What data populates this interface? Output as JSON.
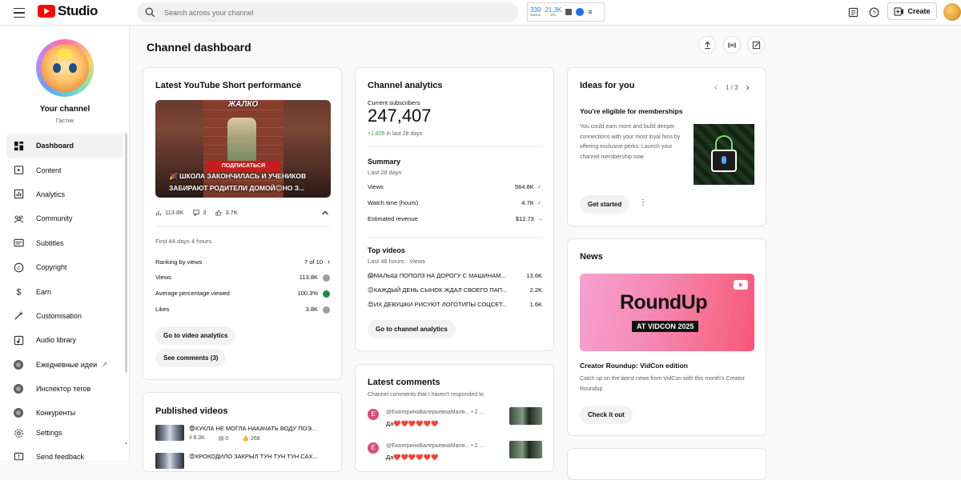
{
  "header": {
    "logo_text": "Studio",
    "search_placeholder": "Search across your channel",
    "ext": {
      "stat1_value": "339",
      "stat1_label": "60мин",
      "stat2_value": "21.3K",
      "stat2_label": "48ч"
    },
    "create_label": "Create"
  },
  "sidebar": {
    "channel_name": "Your channel",
    "channel_handle": "Гастик",
    "items": [
      {
        "label": "Dashboard",
        "icon": "dashboard-icon"
      },
      {
        "label": "Content",
        "icon": "content-icon"
      },
      {
        "label": "Analytics",
        "icon": "analytics-icon"
      },
      {
        "label": "Community",
        "icon": "community-icon"
      },
      {
        "label": "Subtitles",
        "icon": "subtitles-icon"
      },
      {
        "label": "Copyright",
        "icon": "copyright-icon"
      },
      {
        "label": "Earn",
        "icon": "dollar-icon"
      },
      {
        "label": "Customisation",
        "icon": "magic-wand-icon"
      },
      {
        "label": "Audio library",
        "icon": "audio-library-icon"
      },
      {
        "label": "Ежедневные идеи",
        "icon": "extension-icon"
      },
      {
        "label": "Инспектор тегов",
        "icon": "extension-icon"
      },
      {
        "label": "Конкуренты",
        "icon": "extension-icon"
      }
    ],
    "bottom": [
      {
        "label": "Settings",
        "icon": "gear-icon"
      },
      {
        "label": "Send feedback",
        "icon": "feedback-icon"
      }
    ]
  },
  "main": {
    "title": "Channel dashboard",
    "short_card": {
      "title": "Latest YouTube Short performance",
      "thumb_top": "ЖАЛКО",
      "thumb_sub": "ПОДПИСАТЬСЯ",
      "thumb_caption": "🎉 ШКОЛА ЗАКОНЧИЛАСЬ И УЧЕНИКОВ ЗАБИРАЮТ РОДИТЕЛИ ДОМОЙ😊НО З...",
      "views": "113.8K",
      "comments": "3",
      "likes": "3.7K",
      "period": "First 44 days 4 hours",
      "rows": [
        {
          "label": "Ranking by views",
          "value": "7 of 10"
        },
        {
          "label": "Views",
          "value": "113.8K"
        },
        {
          "label": "Average percentage viewed",
          "value": "100.3%"
        },
        {
          "label": "Likes",
          "value": "3.8K"
        }
      ],
      "btn_analytics": "Go to video analytics",
      "btn_comments": "See comments (3)"
    },
    "published": {
      "title": "Published videos",
      "videos": [
        {
          "title": "😨КУКЛА НЕ МОГЛА НАКАЧАТЬ ВОДУ ПОЭ...",
          "views": "8.3K",
          "comments": "0",
          "likes": "268"
        },
        {
          "title": "😡КРОКОДИЛО ЗАКРЫЛ ТУН ТУН ТУН САХ..."
        }
      ]
    },
    "analytics": {
      "title": "Channel analytics",
      "subs_label": "Current subscribers",
      "subs_value": "247,407",
      "subs_change": "+1,826",
      "subs_change_suffix": "in last 28 days",
      "summary_title": "Summary",
      "summary_period": "Last 28 days",
      "summary": [
        {
          "label": "Views",
          "value": "564.8K"
        },
        {
          "label": "Watch time (hours)",
          "value": "4.7K"
        },
        {
          "label": "Estimated revenue",
          "value": "$12.73"
        }
      ],
      "top_title": "Top videos",
      "top_period": "Last 48 hours · Views",
      "top": [
        {
          "title": "😱МАЛЫШ ПОПОЛЗ НА ДОРОГУ С МАШИНАМ...",
          "value": "13.6K"
        },
        {
          "title": "😊КАЖДЫЙ ДЕНЬ СЫНОК ЖДАЛ СВОЕГО ПАП...",
          "value": "2.2K"
        },
        {
          "title": "😍ИХ ДЕВУШКИ РИСУЮТ ЛОГОТИПЫ СОЦСЕТ...",
          "value": "1.6K"
        }
      ],
      "btn": "Go to channel analytics"
    },
    "comments": {
      "title": "Latest comments",
      "subtitle": "Channel comments that I haven't responded to",
      "items": [
        {
          "avatar": "E",
          "author": "@ЕкатеринаВалерьевнаМаля... • 2 ...",
          "text": "Да❤️❤️❤️❤️❤️❤️"
        },
        {
          "avatar": "E",
          "author": "@ЕкатеринаВалерьевнаМаля... • 2 ...",
          "text": "Да❤️❤️❤️❤️❤️❤️"
        }
      ]
    },
    "ideas": {
      "title": "Ideas for you",
      "pager": "1 / 3",
      "heading": "You're eligible for memberships",
      "body": "You could earn more and build deeper connections with your most loyal fans by offering exclusive perks. Launch your channel membership now",
      "btn": "Get started"
    },
    "news": {
      "title": "News",
      "img_main": "RoundUp",
      "img_badge": "AT VIDCON 2025",
      "headline": "Creator Roundup: VidCon edition",
      "body": "Catch up on the latest news from VidCon with this month's Creator Roundup",
      "btn": "Check it out"
    }
  }
}
